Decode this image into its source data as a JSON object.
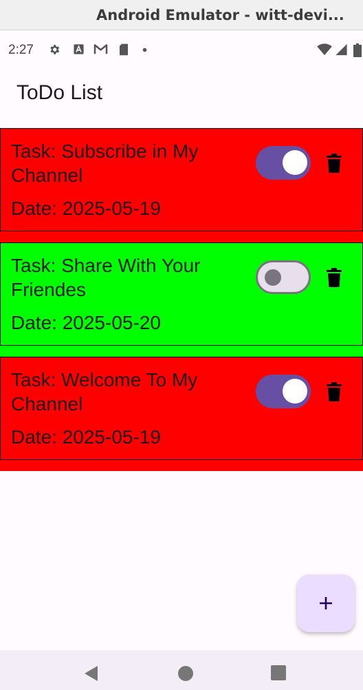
{
  "window": {
    "title": "Android Emulator - witt-devi..."
  },
  "status_bar": {
    "time": "2:27",
    "icons": [
      "settings-icon",
      "font-icon",
      "gmail-icon",
      "sd-card-icon",
      "notification-dot-icon",
      "wifi-icon",
      "signal-icon",
      "battery-icon"
    ]
  },
  "app": {
    "title": "ToDo List"
  },
  "tasks": [
    {
      "name": "Task: Subscribe in My Channel",
      "date": "Date: 2025-05-19",
      "done": true,
      "color": "#ff0000"
    },
    {
      "name": "Task: Share With Your Friendes",
      "date": "Date: 2025-05-20",
      "done": false,
      "color": "#00ff00"
    },
    {
      "name": "Task: Welcome To My Channel",
      "date": "Date: 2025-05-19",
      "done": true,
      "color": "#ff0000"
    }
  ],
  "fab": {
    "icon": "plus-icon"
  },
  "nav": {
    "buttons": [
      "back-icon",
      "home-icon",
      "recents-icon"
    ]
  },
  "colors": {
    "toggle_on": "#6750a4",
    "toggle_off_track": "#e7e0ec",
    "fab_background": "#eaddff",
    "background": "#fffbfe"
  }
}
